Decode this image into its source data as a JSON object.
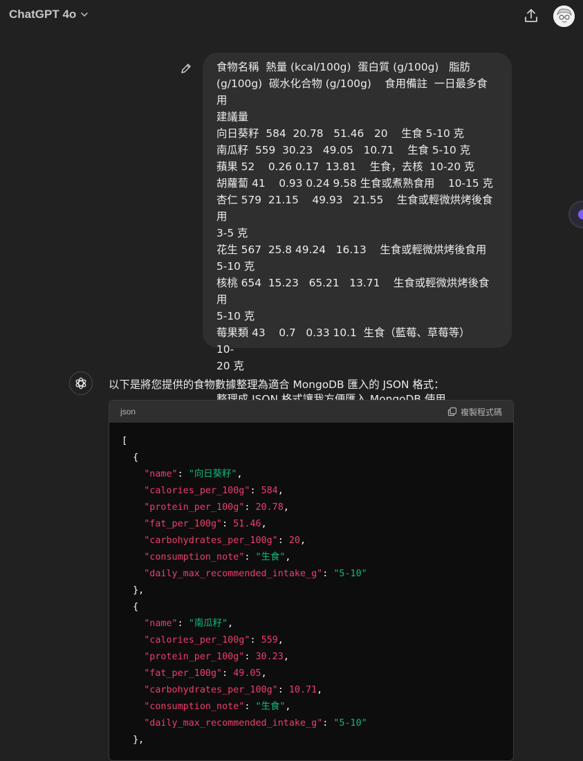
{
  "header": {
    "model_name": "ChatGPT 4o"
  },
  "user_message": {
    "text": "食物名稱  熱量 (kcal/100g)  蛋白質 (g/100g)   脂肪\n(g/100g)  碳水化合物 (g/100g)    食用備註  一日最多食用\n建議量\n向日葵籽  584  20.78   51.46   20    生食 5-10 克\n南瓜籽  559  30.23   49.05   10.71    生食 5-10 克\n蘋果 52    0.26 0.17  13.81    生食，去核  10-20 克\n胡蘿蔔 41    0.93 0.24 9.58 生食或煮熟食用    10-15 克\n杏仁 579  21.15    49.93   21.55    生食或輕微烘烤後食用\n3-5 克\n花生 567  25.8 49.24   16.13    生食或輕微烘烤後食用\n5-10 克\n核桃 654  15.23   65.21   13.71    生食或輕微烘烤後食用\n5-10 克\n莓果類 43    0.7   0.33 10.1  生食（藍莓、草莓等）     10-\n20 克\n\n整理成 JSON 格式讓我方便匯入 MongoDB 使用"
  },
  "assistant_message": {
    "intro": "以下是將您提供的食物數據整理為適合 MongoDB 匯入的 JSON 格式：",
    "code_block": {
      "language": "json",
      "copy_label": "複製程式碼",
      "open_bracket": "[",
      "items": [
        {
          "name": "向日葵籽",
          "calories_per_100g": "584",
          "protein_per_100g": "20.78",
          "fat_per_100g": "51.46",
          "carbohydrates_per_100g": "20",
          "consumption_note": "生食",
          "daily_max_recommended_intake_g": "5-10"
        },
        {
          "name": "南瓜籽",
          "calories_per_100g": "559",
          "protein_per_100g": "30.23",
          "fat_per_100g": "49.05",
          "carbohydrates_per_100g": "10.71",
          "consumption_note": "生食",
          "daily_max_recommended_intake_g": "5-10"
        }
      ]
    }
  },
  "colors": {
    "background": "#212121",
    "bubble": "#2f2f2f",
    "code_bg": "#0d0d0d",
    "json_key": "#ef3e6f",
    "json_string": "#10b981"
  }
}
